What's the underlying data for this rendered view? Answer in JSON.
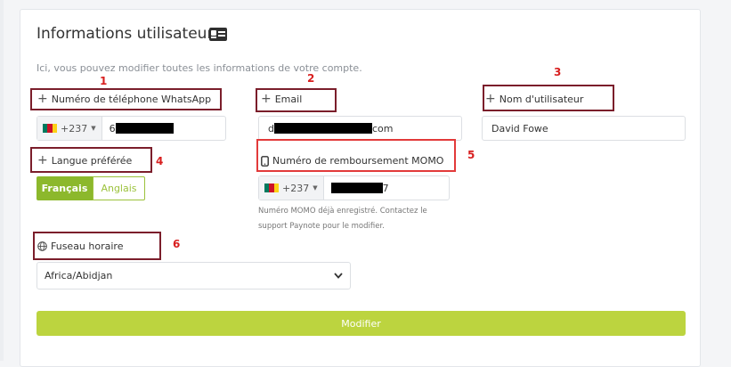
{
  "card": {
    "title": "Informations utilisateur",
    "subtitle": "Ici, vous pouvez modifier toutes les informations de votre compte."
  },
  "fields": {
    "whatsapp": {
      "label": "Numéro de téléphone WhatsApp",
      "country_code": "+237",
      "value_visible": "6"
    },
    "email": {
      "label": "Email",
      "value_start": "d",
      "value_end": "com"
    },
    "username": {
      "label": "Nom d'utilisateur",
      "value": "David Fowe"
    },
    "language": {
      "label": "Langue préférée",
      "options": [
        "Français",
        "Anglais"
      ],
      "selected": "Français"
    },
    "momo": {
      "label": "Numéro de remboursement MOMO",
      "country_code": "+237",
      "value_end": "7",
      "help": "Numéro MOMO déjà enregistré. Contactez le support Paynote pour le modifier."
    },
    "timezone": {
      "label": "Fuseau horaire",
      "value": "Africa/Abidjan"
    }
  },
  "submit_label": "Modifier",
  "annotations": [
    "1",
    "2",
    "3",
    "4",
    "5",
    "6"
  ],
  "colors": {
    "accent": "#8cb82c",
    "submit": "#bcd43f",
    "annotation_box": "#7b1e2b",
    "annotation_box_highlight": "#e23a3a",
    "annotation_number": "#d81f1f"
  },
  "icons": {
    "title": "id-card-icon",
    "add": "plus-icon",
    "phone": "mobile-phone-icon",
    "timezone": "globe-icon",
    "dropdown": "chevron-down-icon"
  }
}
